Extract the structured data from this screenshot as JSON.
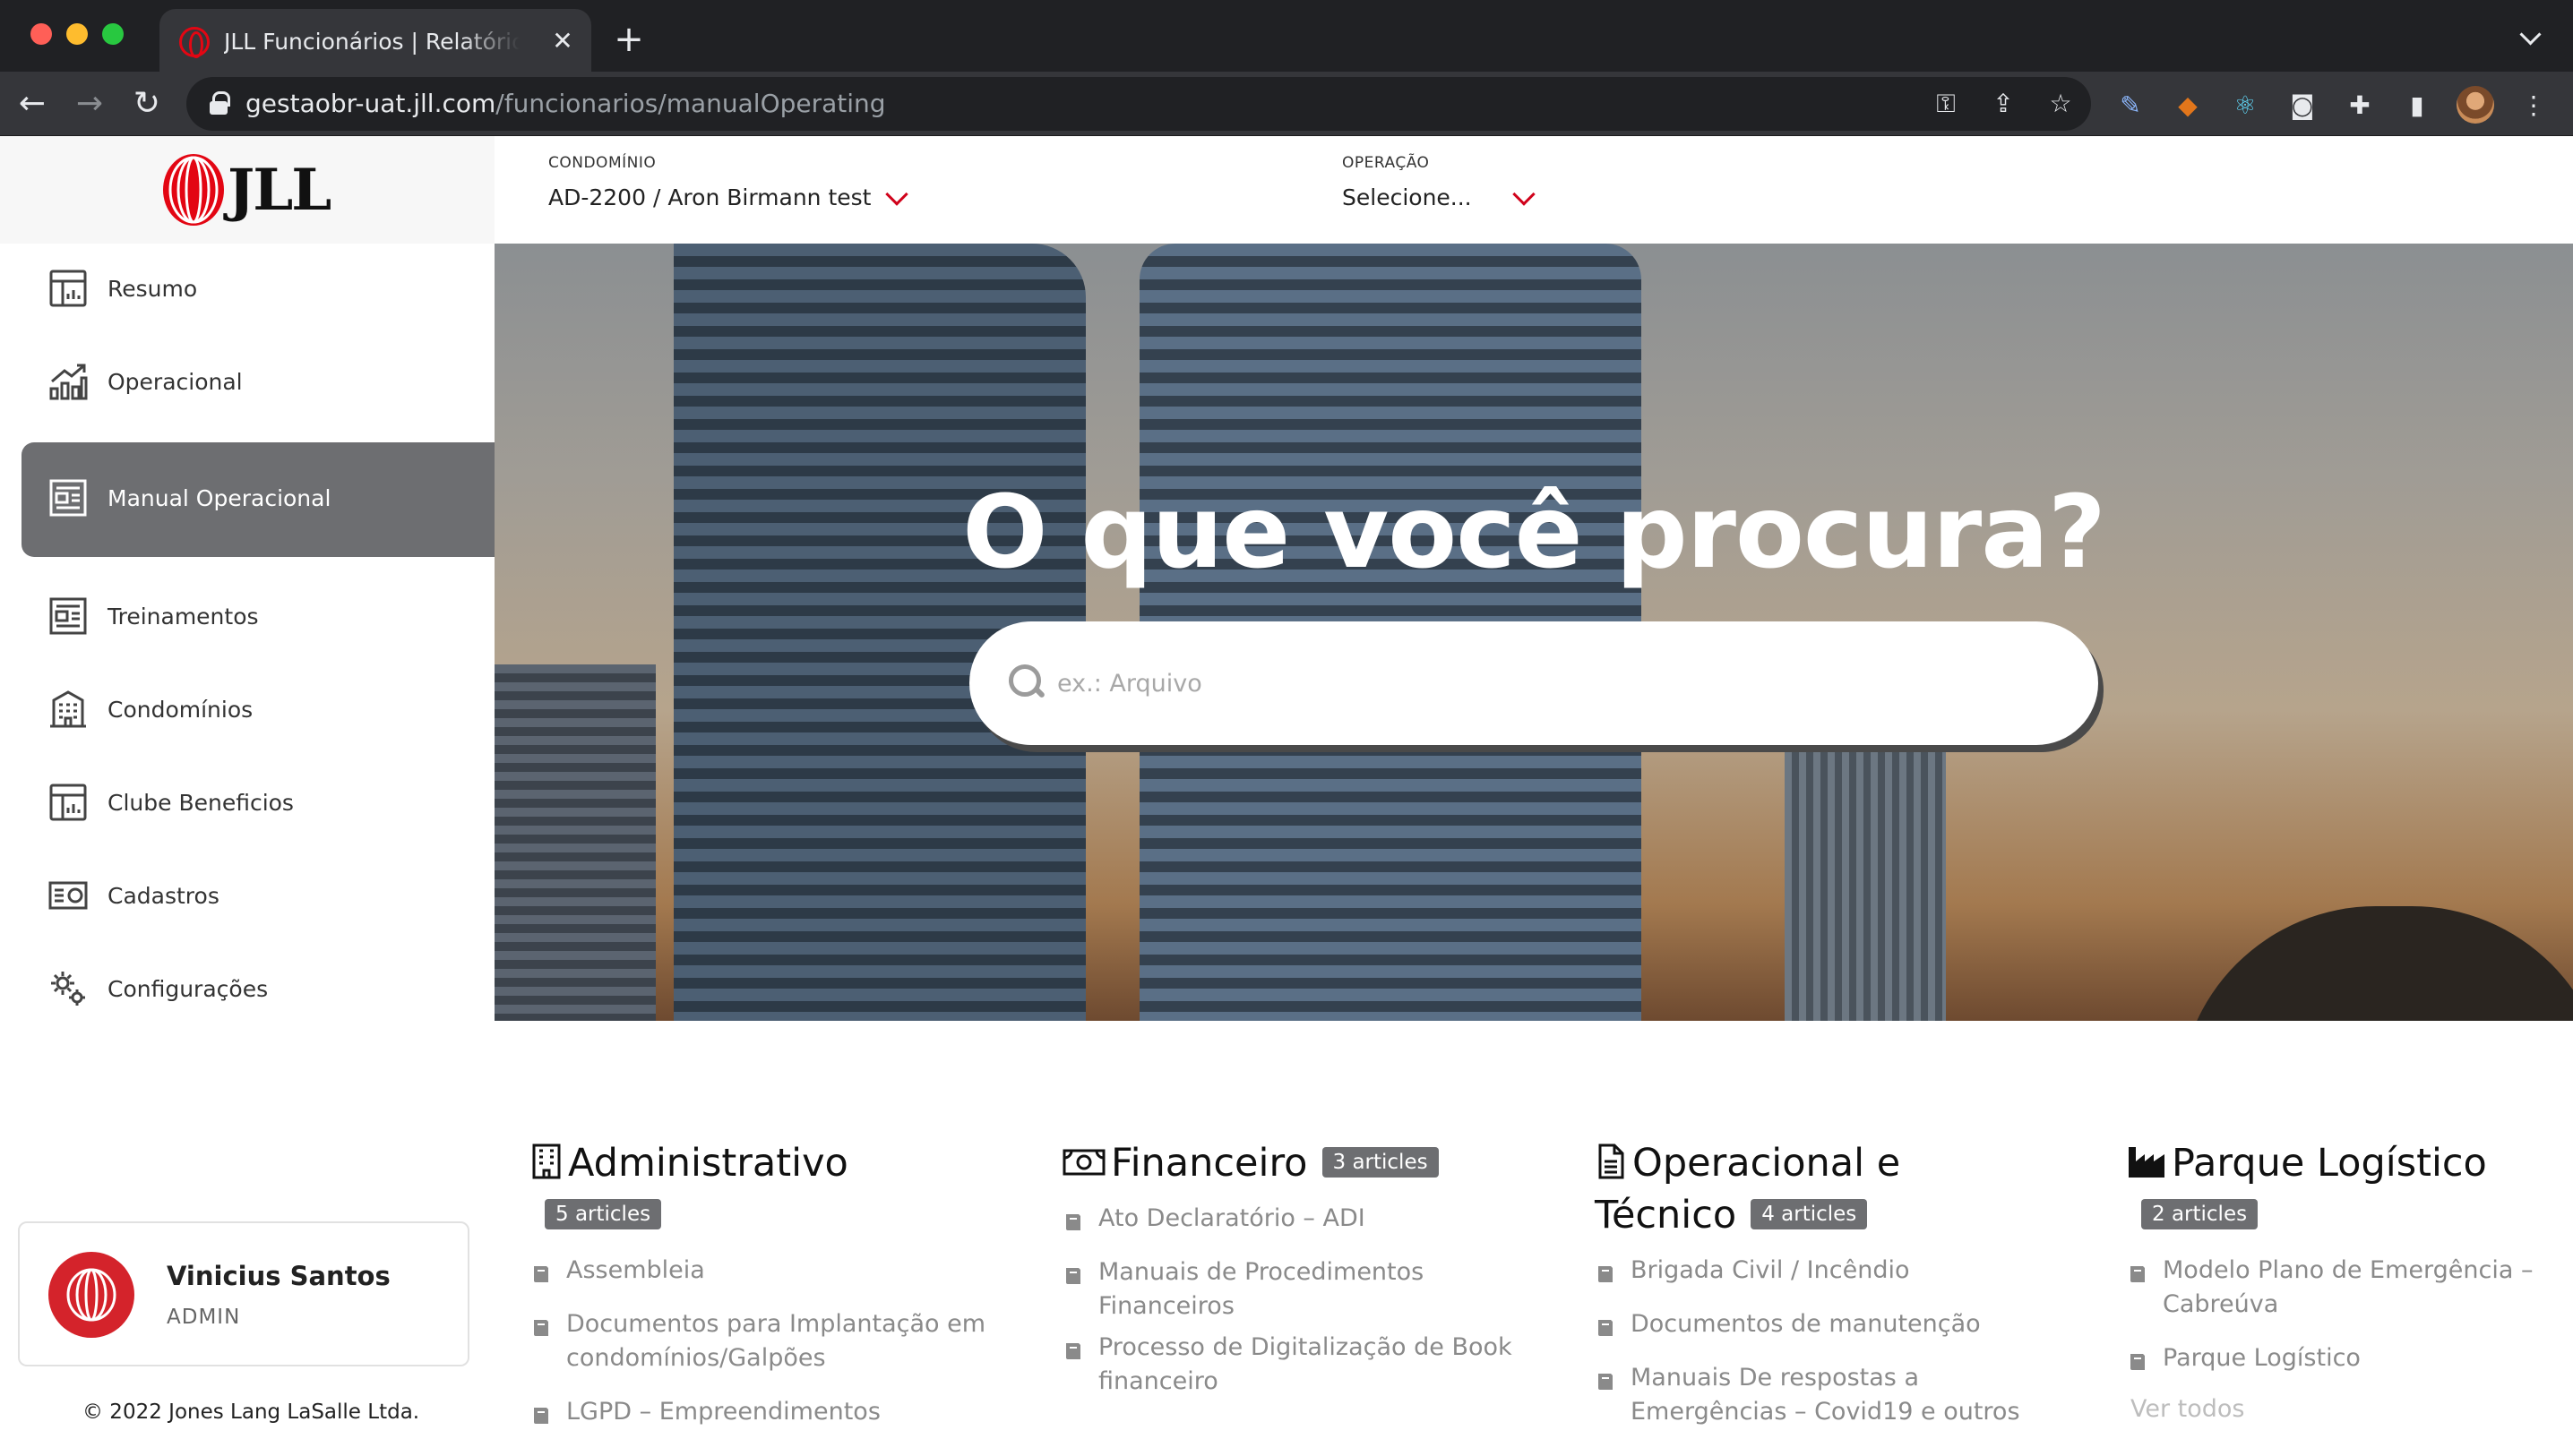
{
  "browser": {
    "tab_title": "JLL Funcionários | Relatório operacional",
    "url_domain": "gestaobr-uat.jll.com",
    "url_path": "/funcionarios/manualOperating"
  },
  "header": {
    "logo_text": "JLL",
    "condominio": {
      "label": "CONDOMÍNIO",
      "value": "AD-2200 / Aron Birmann test"
    },
    "operacao": {
      "label": "OPERAÇÃO",
      "value": "Selecione..."
    }
  },
  "sidebar": {
    "items": [
      {
        "label": "Resumo",
        "icon": "report-icon"
      },
      {
        "label": "Operacional",
        "icon": "growth-chart-icon"
      },
      {
        "label": "Manual Operacional",
        "icon": "newspaper-icon"
      },
      {
        "label": "Treinamentos",
        "icon": "newspaper-icon"
      },
      {
        "label": "Condomínios",
        "icon": "building-icon"
      },
      {
        "label": "Clube Beneficios",
        "icon": "report-icon"
      },
      {
        "label": "Cadastros",
        "icon": "id-card-icon"
      },
      {
        "label": "Configurações",
        "icon": "gears-icon"
      }
    ]
  },
  "user": {
    "name": "Vinicius Santos",
    "role": "ADMIN"
  },
  "footer": {
    "copyright": "© 2022 Jones Lang LaSalle Ltda."
  },
  "hero": {
    "title": "O que você procura?",
    "search_placeholder": "ex.: Arquivo"
  },
  "categories": [
    {
      "title": "Administrativo",
      "icon": "building-icon",
      "badge": "5 articles",
      "articles": [
        "Assembleia",
        "Documentos para Implantação em condomínios/Galpões",
        "LGPD – Empreendimentos"
      ]
    },
    {
      "title": "Financeiro",
      "icon": "money-icon",
      "badge": "3 articles",
      "articles": [
        "Ato Declaratório – ADI",
        "Manuais de Procedimentos Financeiros",
        "Processo de Digitalização de Book financeiro"
      ]
    },
    {
      "title": "Operacional e Técnico",
      "icon": "document-icon",
      "badge": "4 articles",
      "articles": [
        "Brigada Civil / Incêndio",
        "Documentos de manutenção",
        "Manuais De respostas a Emergências – Covid19 e outros"
      ]
    },
    {
      "title": "Parque Logístico",
      "icon": "industry-icon",
      "badge": "2 articles",
      "articles": [
        "Modelo Plano de Emergência – Cabreúva",
        "Parque Logístico"
      ],
      "see_all": "Ver todos"
    }
  ],
  "colors": {
    "brand_red": "#e30613",
    "active_sidebar": "#6d6e71",
    "badge": "#6d6e71"
  }
}
